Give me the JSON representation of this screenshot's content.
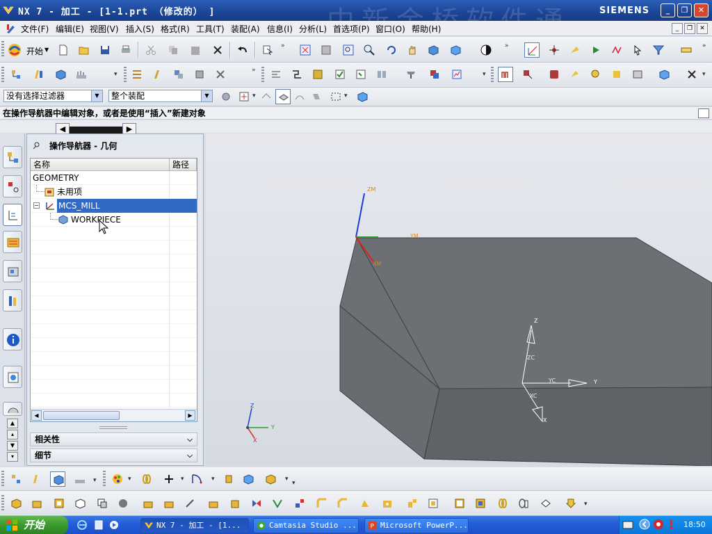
{
  "window": {
    "title": "NX 7 - 加工 - [1-1.prt （修改的） ]",
    "brand": "SIEMENS",
    "watermark": "中新金桥软件通"
  },
  "menu": {
    "items": [
      "文件(F)",
      "编辑(E)",
      "视图(V)",
      "插入(S)",
      "格式(R)",
      "工具(T)",
      "装配(A)",
      "信息(I)",
      "分析(L)",
      "首选项(P)",
      "窗口(O)",
      "帮助(H)"
    ]
  },
  "toolbar": {
    "start_label": "开始"
  },
  "selection": {
    "filter_value": "没有选择过滤器",
    "scope_value": "整个装配"
  },
  "cue_line": "在操作导航器中编辑对象，或者是使用“插入”新建对象",
  "navigator": {
    "title": "操作导航器 - 几何",
    "col_name": "名称",
    "col_path": "路径",
    "rows": [
      {
        "label": "GEOMETRY",
        "selected": false
      },
      {
        "label": "未用项",
        "selected": false
      },
      {
        "label": "MCS_MILL",
        "selected": true
      },
      {
        "label": "WORKPIECE",
        "selected": false
      }
    ],
    "sections": [
      "相关性",
      "细节"
    ]
  },
  "graphics": {
    "block_color": "#6a6e72",
    "edge_color": "#3a3d40",
    "wcs_labels": [
      "Z",
      "ZC",
      "YC",
      "Y",
      "XC",
      "X"
    ],
    "triad_labels": [
      "Z",
      "Y",
      "X"
    ],
    "mcs_labels": [
      "ZM",
      "YM",
      "XM"
    ]
  },
  "taskbar": {
    "start_label": "开始",
    "tasks": [
      "NX 7 - 加工 - [1...",
      "Camtasia Studio ...",
      "Microsoft PowerP..."
    ],
    "clock": "18:50"
  }
}
